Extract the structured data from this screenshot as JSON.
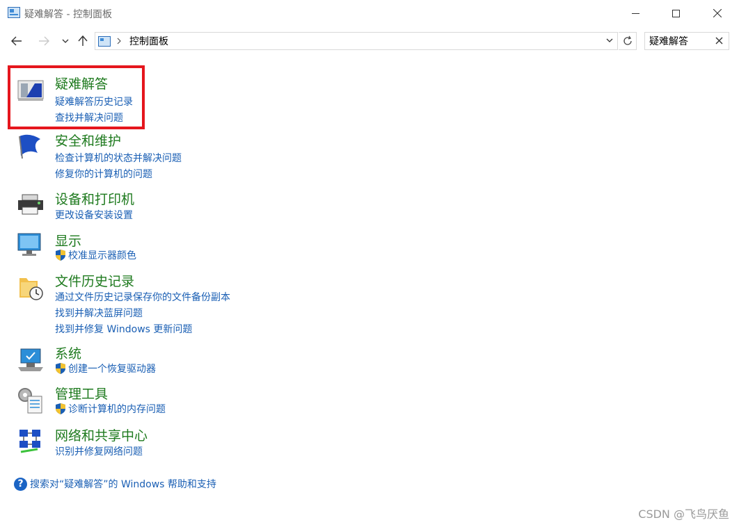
{
  "window": {
    "title": "疑难解答 - 控制面板",
    "minimize_label": "—",
    "maximize_label": "☐",
    "close_label": "✕"
  },
  "nav": {
    "back_icon": "arrow-left-icon",
    "forward_icon": "arrow-right-icon",
    "recent_icon": "chevron-down-icon",
    "up_icon": "arrow-up-icon",
    "breadcrumb": "控制面板",
    "refresh_icon": "refresh-icon",
    "search_value": "疑难解答"
  },
  "categories": [
    {
      "title": "疑难解答",
      "icon": "troubleshooting-icon",
      "links": [
        "疑难解答历史记录",
        "查找并解决问题"
      ]
    },
    {
      "title": "安全和维护",
      "icon": "flag-icon",
      "links": [
        "检查计算机的状态并解决问题",
        "修复你的计算机的问题"
      ]
    },
    {
      "title": "设备和打印机",
      "icon": "printer-icon",
      "links": [
        "更改设备安装设置"
      ]
    },
    {
      "title": "显示",
      "icon": "monitor-icon",
      "links": [
        "校准显示器颜色"
      ]
    },
    {
      "title": "文件历史记录",
      "icon": "file-history-icon",
      "links": [
        "通过文件历史记录保存你的文件备份副本",
        "找到并解决蓝屏问题",
        "找到并修复 Windows 更新问题"
      ]
    },
    {
      "title": "系统",
      "icon": "computer-icon",
      "links": [
        "创建一个恢复驱动器"
      ]
    },
    {
      "title": "管理工具",
      "icon": "admin-tools-icon",
      "links": [
        "诊断计算机的内存问题"
      ]
    },
    {
      "title": "网络和共享中心",
      "icon": "network-icon",
      "links": [
        "识别并修复网络问题"
      ]
    }
  ],
  "help": {
    "icon": "help-icon",
    "text": "搜索对“疑难解答”的 Windows 帮助和支持"
  },
  "watermark": "CSDN @飞鸟厌鱼",
  "colors": {
    "category_title": "#1e7a1e",
    "link": "#1a5fb4",
    "highlight": "#e5161d"
  }
}
